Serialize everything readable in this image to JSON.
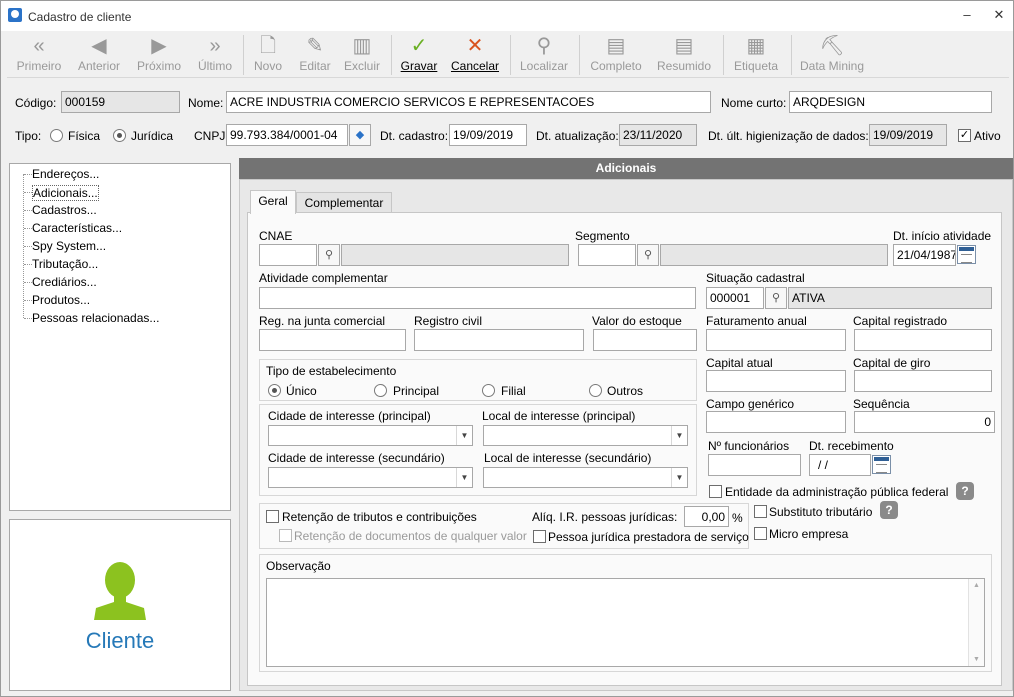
{
  "window": {
    "title": "Cadastro de cliente",
    "minimize": "‒",
    "close": "✕"
  },
  "toolbar": {
    "first": "Primeiro",
    "prev": "Anterior",
    "next": "Próximo",
    "last": "Último",
    "new": "Novo",
    "edit": "Editar",
    "delete": "Excluir",
    "save": "Gravar",
    "cancel": "Cancelar",
    "find": "Localizar",
    "full": "Completo",
    "summary": "Resumido",
    "label": "Etiqueta",
    "data_mining": "Data Mining"
  },
  "header": {
    "codigo_label": "Código:",
    "codigo": "000159",
    "nome_label": "Nome:",
    "nome": "ACRE INDUSTRIA COMERCIO SERVICOS E REPRESENTACOES",
    "nome_curto_label": "Nome curto:",
    "nome_curto": "ARQDESIGN",
    "tipo_label": "Tipo:",
    "tipo_fisica": "Física",
    "tipo_juridica": "Jurídica",
    "cnpj_label": "CNPJ:",
    "cnpj": "99.793.384/0001-04",
    "dt_cadastro_label": "Dt. cadastro:",
    "dt_cadastro": "19/09/2019",
    "dt_atualizacao_label": "Dt. atualização:",
    "dt_atualizacao": "23/11/2020",
    "dt_higienizacao_label": "Dt. últ. higienização de dados:",
    "dt_higienizacao": "19/09/2019",
    "ativo_label": "Ativo"
  },
  "tree": {
    "items": [
      "Endereços...",
      "Adicionais...",
      "Cadastros...",
      "Características...",
      "Spy System...",
      "Tributação...",
      "Crediários...",
      "Produtos...",
      "Pessoas relacionadas..."
    ]
  },
  "logo": {
    "caption": "Cliente"
  },
  "section_title": "Adicionais",
  "tabs": {
    "geral": "Geral",
    "complementar": "Complementar"
  },
  "form": {
    "cnae_label": "CNAE",
    "segmento_label": "Segmento",
    "dt_inicio_label": "Dt. início atividade",
    "dt_inicio": "21/04/1987",
    "atividade_label": "Atividade complementar",
    "situacao_label": "Situação cadastral",
    "situacao_code": "000001",
    "situacao_desc": "ATIVA",
    "reg_junta_label": "Reg. na junta comercial",
    "registro_civil_label": "Registro civil",
    "valor_estoque_label": "Valor do estoque",
    "faturamento_label": "Faturamento anual",
    "capital_registrado_label": "Capital registrado",
    "tipo_estab_label": "Tipo de estabelecimento",
    "estab_unico": "Único",
    "estab_principal": "Principal",
    "estab_filial": "Filial",
    "estab_outros": "Outros",
    "capital_atual_label": "Capital atual",
    "capital_giro_label": "Capital de giro",
    "cidade_principal_label": "Cidade de interesse (principal)",
    "local_principal_label": "Local de interesse (principal)",
    "campo_generico_label": "Campo genérico",
    "sequencia_label": "Sequência",
    "sequencia": "0",
    "cidade_secundario_label": "Cidade de interesse (secundário)",
    "local_secundario_label": "Local de interesse (secundário)",
    "funcionarios_label": "Nº funcionários",
    "dt_recebimento_label": "Dt. recebimento",
    "dt_recebimento": " / /",
    "entidade_label": "Entidade da administração pública federal",
    "retencao_label": "Retenção de tributos e contribuições",
    "retencao_docs_label": "Retenção de documentos de qualquer valor",
    "aliq_label": "Alíq.  I.R. pessoas jurídicas:",
    "aliq": "0,00",
    "aliq_unit": "%",
    "pj_prestadora_label": "Pessoa jurídica prestadora de serviço",
    "substituto_label": "Substituto tributário",
    "micro_label": "Micro empresa",
    "observacao_label": "Observação",
    "help": "?"
  }
}
